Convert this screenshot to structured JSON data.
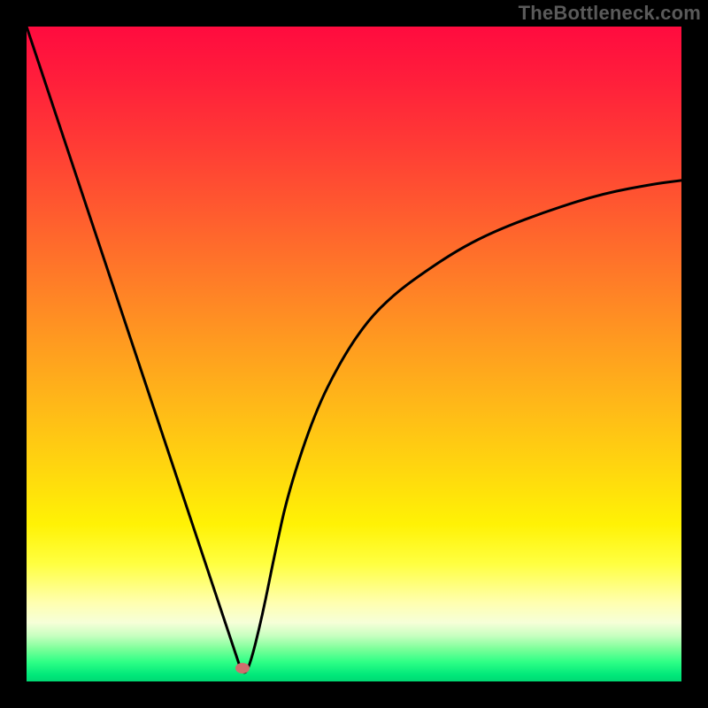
{
  "watermark": "TheBottleneck.com",
  "chart_data": {
    "type": "line",
    "title": "",
    "xlabel": "",
    "ylabel": "",
    "xlim": [
      0,
      100
    ],
    "ylim": [
      0,
      100
    ],
    "x": [
      0,
      4,
      8,
      12,
      16,
      20,
      24,
      28,
      30,
      32,
      33,
      34,
      36,
      38,
      40,
      44,
      48,
      52,
      56,
      60,
      66,
      72,
      80,
      88,
      96,
      100
    ],
    "values": [
      100,
      88,
      76,
      64,
      52,
      40,
      28,
      16,
      10,
      4,
      1,
      2,
      10,
      20,
      29,
      41,
      49,
      55,
      59,
      62,
      66,
      69,
      72,
      74.5,
      76,
      76.5
    ],
    "curve_minimum": {
      "x": 33,
      "y": 0
    },
    "marker": {
      "x": 33,
      "y": 2
    },
    "background": {
      "type": "vertical-gradient",
      "stops": [
        {
          "pct": 0,
          "color": "#ff0b3f"
        },
        {
          "pct": 50,
          "color": "#ff9a20"
        },
        {
          "pct": 76,
          "color": "#fff205"
        },
        {
          "pct": 90,
          "color": "#ffffb0"
        },
        {
          "pct": 100,
          "color": "#00d873"
        }
      ]
    }
  },
  "colors": {
    "curve": "#000000",
    "marker": "#cf6e6e",
    "frame": "#000000",
    "watermark": "#5a5a5a"
  }
}
